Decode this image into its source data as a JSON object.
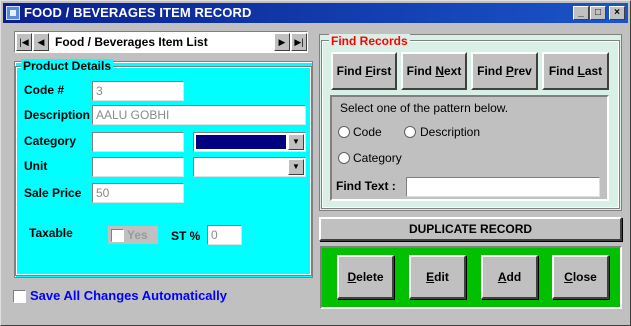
{
  "window": {
    "title": "FOOD / BEVERAGES ITEM RECORD",
    "controls": {
      "minimize": "_",
      "maximize": "□",
      "close": "×"
    }
  },
  "nav": {
    "caption": "Food / Beverages Item List",
    "buttons": {
      "first": "|◀",
      "prev": "◀",
      "next": "▶",
      "last": "▶|"
    }
  },
  "product": {
    "group_title": "Product Details",
    "code_label": "Code #",
    "code_value": "3",
    "description_label": "Description",
    "description_value": "AALU GOBHI",
    "category_label": "Category",
    "category_value": "",
    "category_selected": "",
    "unit_label": "Unit",
    "unit_value": "",
    "unit_selected": "",
    "sale_price_label": "Sale Price",
    "sale_price_value": "50",
    "taxable_label": "Taxable",
    "taxable_checkbox_label": "Yes",
    "st_label": "ST %",
    "st_value": "0"
  },
  "save_all": {
    "label": "Save All Changes Automatically"
  },
  "find": {
    "group_title": "Find Records",
    "buttons": [
      {
        "pre": "Find ",
        "key": "F",
        "post": "irst"
      },
      {
        "pre": "Find ",
        "key": "N",
        "post": "ext"
      },
      {
        "pre": "Find ",
        "key": "P",
        "post": "rev"
      },
      {
        "pre": "Find ",
        "key": "L",
        "post": "ast"
      }
    ],
    "pattern_prompt": "Select one of the pattern below.",
    "options": {
      "code": "Code",
      "description": "Description",
      "category": "Category"
    },
    "find_text_label": "Find Text :",
    "find_text_value": ""
  },
  "duplicate": {
    "label": "DUPLICATE RECORD"
  },
  "actions": [
    {
      "key": "D",
      "rest": "elete"
    },
    {
      "key": "E",
      "rest": "dit"
    },
    {
      "key": "A",
      "rest": "dd"
    },
    {
      "key": "C",
      "rest": "lose"
    }
  ],
  "colors": {
    "title_bar": "#0a1e8c",
    "product_panel": "#00ffff",
    "find_panel": "#d9f0e6",
    "find_title": "#ff0000",
    "actions_panel": "#00c000",
    "save_all_text": "#0000ff",
    "category_selection": "#000080"
  }
}
